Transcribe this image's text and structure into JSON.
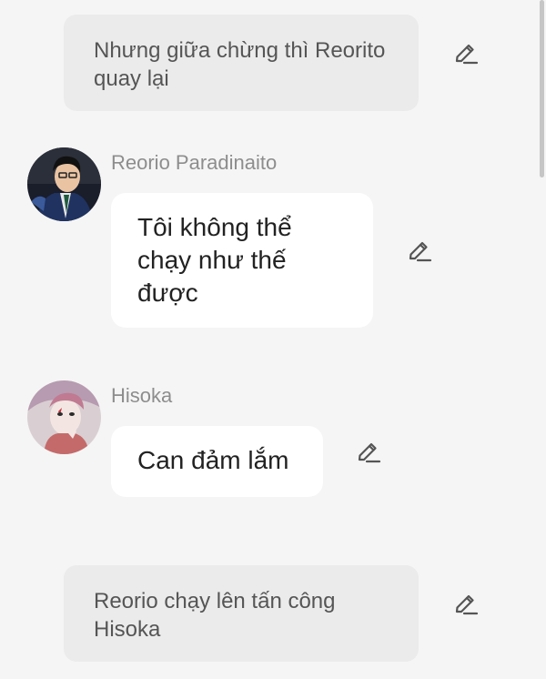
{
  "messages": [
    {
      "type": "narration",
      "text": "Nhưng giữa chừng thì Reorito quay lại",
      "edit_icon": "pencil-icon"
    },
    {
      "type": "character",
      "avatar": "reorio-avatar",
      "name": "Reorio Paradinaito",
      "text": "Tôi không thể chạy như thế được",
      "edit_icon": "pencil-icon"
    },
    {
      "type": "character",
      "avatar": "hisoka-avatar",
      "name": "Hisoka",
      "text": "Can đảm lắm",
      "edit_icon": "pencil-icon"
    },
    {
      "type": "narration",
      "text": "Reorio chạy lên tấn công Hisoka",
      "edit_icon": "pencil-icon"
    }
  ],
  "colors": {
    "background": "#f5f5f5",
    "narration_bubble": "#ebebeb",
    "character_bubble": "#ffffff",
    "name_text": "#8d8d8d"
  }
}
